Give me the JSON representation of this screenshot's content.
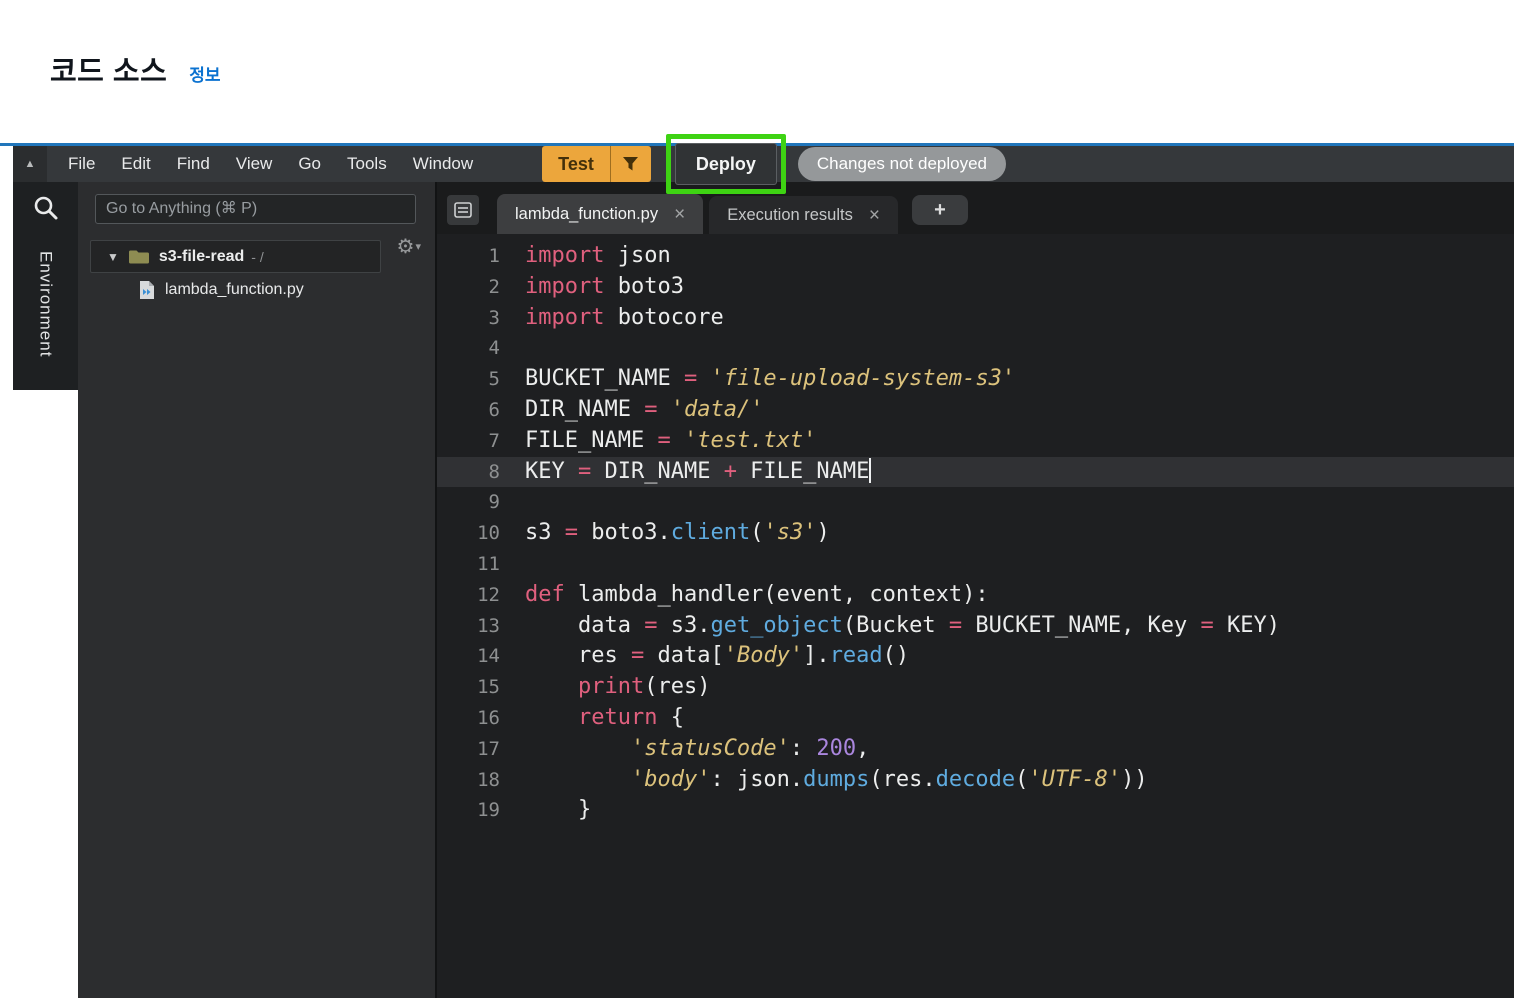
{
  "header": {
    "title": "코드 소스",
    "info_link": "정보"
  },
  "menubar": {
    "items": [
      "File",
      "Edit",
      "Find",
      "View",
      "Go",
      "Tools",
      "Window"
    ],
    "test_button": "Test",
    "deploy_button": "Deploy",
    "status_badge": "Changes not deployed"
  },
  "dock": {
    "panel_label": "Environment"
  },
  "explorer": {
    "goto_placeholder": "Go to Anything (⌘ P)",
    "folder_name": "s3-file-read",
    "folder_suffix": "- /",
    "file_name": "lambda_function.py"
  },
  "tabs": {
    "items": [
      {
        "label": "lambda_function.py",
        "close": "×",
        "active": true
      },
      {
        "label": "Execution results",
        "close": "×",
        "active": false
      }
    ],
    "new_tab": "+"
  },
  "editor": {
    "active_line": 8,
    "lines": [
      {
        "tokens": [
          {
            "t": "k",
            "v": "import"
          },
          {
            "t": "p",
            "v": " json"
          }
        ]
      },
      {
        "tokens": [
          {
            "t": "k",
            "v": "import"
          },
          {
            "t": "p",
            "v": " boto3"
          }
        ]
      },
      {
        "tokens": [
          {
            "t": "k",
            "v": "import"
          },
          {
            "t": "p",
            "v": " botocore"
          }
        ]
      },
      {
        "tokens": []
      },
      {
        "tokens": [
          {
            "t": "p",
            "v": "BUCKET_NAME "
          },
          {
            "t": "o",
            "v": "="
          },
          {
            "t": "p",
            "v": " "
          },
          {
            "t": "s",
            "v": "'file-upload-system-s3'"
          }
        ]
      },
      {
        "tokens": [
          {
            "t": "p",
            "v": "DIR_NAME "
          },
          {
            "t": "o",
            "v": "="
          },
          {
            "t": "p",
            "v": " "
          },
          {
            "t": "s",
            "v": "'data/'"
          }
        ]
      },
      {
        "tokens": [
          {
            "t": "p",
            "v": "FILE_NAME "
          },
          {
            "t": "o",
            "v": "="
          },
          {
            "t": "p",
            "v": " "
          },
          {
            "t": "s",
            "v": "'test.txt'"
          }
        ]
      },
      {
        "tokens": [
          {
            "t": "p",
            "v": "KEY "
          },
          {
            "t": "o",
            "v": "="
          },
          {
            "t": "p",
            "v": " DIR_NAME "
          },
          {
            "t": "o",
            "v": "+"
          },
          {
            "t": "p",
            "v": " FILE_NAME"
          }
        ],
        "cursor": true
      },
      {
        "tokens": []
      },
      {
        "tokens": [
          {
            "t": "p",
            "v": "s3 "
          },
          {
            "t": "o",
            "v": "="
          },
          {
            "t": "p",
            "v": " boto3."
          },
          {
            "t": "f",
            "v": "client"
          },
          {
            "t": "p",
            "v": "("
          },
          {
            "t": "s",
            "v": "'s3'"
          },
          {
            "t": "p",
            "v": ")"
          }
        ]
      },
      {
        "tokens": []
      },
      {
        "tokens": [
          {
            "t": "k",
            "v": "def"
          },
          {
            "t": "p",
            "v": " lambda_handler(event, context):"
          }
        ]
      },
      {
        "tokens": [
          {
            "t": "p",
            "v": "    data "
          },
          {
            "t": "o",
            "v": "="
          },
          {
            "t": "p",
            "v": " s3."
          },
          {
            "t": "f",
            "v": "get_object"
          },
          {
            "t": "p",
            "v": "(Bucket "
          },
          {
            "t": "o",
            "v": "="
          },
          {
            "t": "p",
            "v": " BUCKET_NAME, Key "
          },
          {
            "t": "o",
            "v": "="
          },
          {
            "t": "p",
            "v": " KEY)"
          }
        ]
      },
      {
        "tokens": [
          {
            "t": "p",
            "v": "    res "
          },
          {
            "t": "o",
            "v": "="
          },
          {
            "t": "p",
            "v": " data["
          },
          {
            "t": "s",
            "v": "'Body'"
          },
          {
            "t": "p",
            "v": "]."
          },
          {
            "t": "f",
            "v": "read"
          },
          {
            "t": "p",
            "v": "()"
          }
        ]
      },
      {
        "tokens": [
          {
            "t": "p",
            "v": "    "
          },
          {
            "t": "k",
            "v": "print"
          },
          {
            "t": "p",
            "v": "(res)"
          }
        ]
      },
      {
        "tokens": [
          {
            "t": "p",
            "v": "    "
          },
          {
            "t": "k",
            "v": "return"
          },
          {
            "t": "p",
            "v": " {"
          }
        ]
      },
      {
        "tokens": [
          {
            "t": "p",
            "v": "        "
          },
          {
            "t": "s",
            "v": "'statusCode'"
          },
          {
            "t": "p",
            "v": ": "
          },
          {
            "t": "n",
            "v": "200"
          },
          {
            "t": "p",
            "v": ","
          }
        ]
      },
      {
        "tokens": [
          {
            "t": "p",
            "v": "        "
          },
          {
            "t": "s",
            "v": "'body'"
          },
          {
            "t": "p",
            "v": ": json."
          },
          {
            "t": "f",
            "v": "dumps"
          },
          {
            "t": "p",
            "v": "(res."
          },
          {
            "t": "f",
            "v": "decode"
          },
          {
            "t": "p",
            "v": "("
          },
          {
            "t": "s",
            "v": "'UTF-8'"
          },
          {
            "t": "p",
            "v": "))"
          }
        ]
      },
      {
        "tokens": [
          {
            "t": "p",
            "v": "    }"
          }
        ]
      }
    ]
  },
  "colors": {
    "accent_blue": "#2176bb",
    "test_orange": "#eca63c",
    "annotation_green": "#3ed313",
    "badge_gray": "#95989a",
    "keyword_pink": "#e0607e",
    "string_gold": "#dcc27c",
    "function_blue": "#5fabdf",
    "number_purple": "#aa86de"
  }
}
